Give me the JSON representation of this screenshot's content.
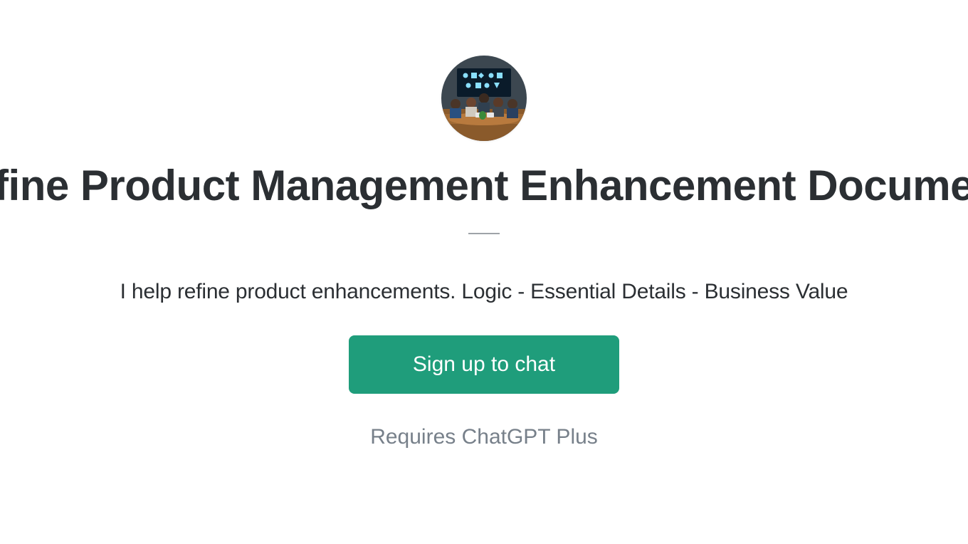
{
  "header": {
    "title": "fine Product Management Enhancement Docume",
    "subtitle": "I help refine product enhancements. Logic - Essential Details - Business Value"
  },
  "cta": {
    "signup_label": "Sign up to chat",
    "requires_label": "Requires ChatGPT Plus"
  },
  "colors": {
    "accent": "#1f9d7b",
    "text_primary": "#2b2f33",
    "text_muted": "#77808a"
  },
  "avatar": {
    "alt": "meeting-room-avatar"
  }
}
